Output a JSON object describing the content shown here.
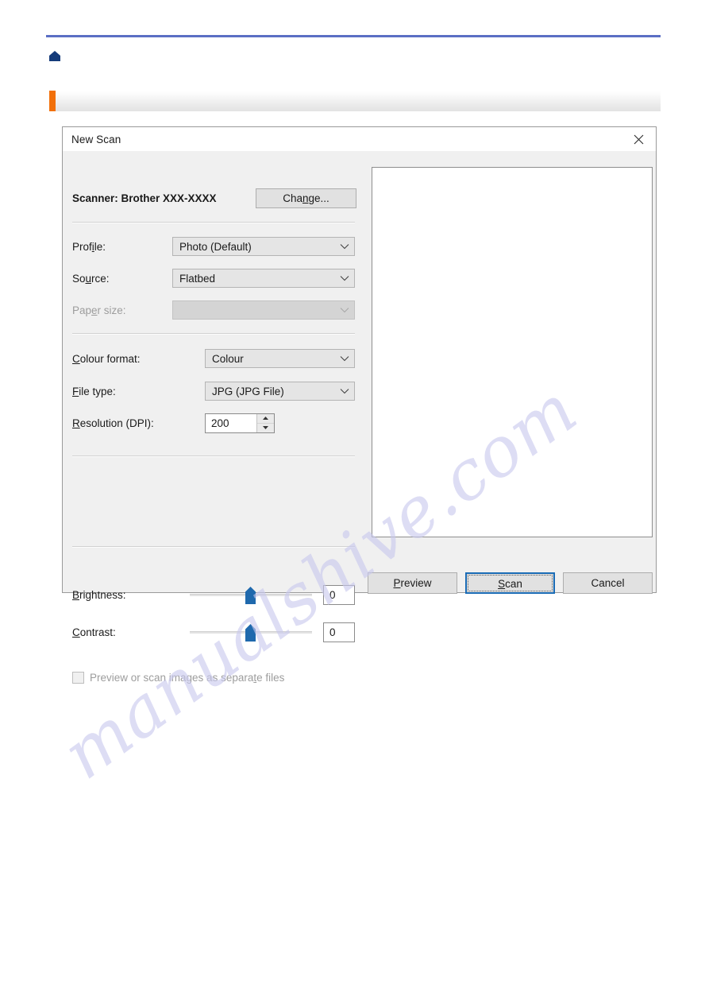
{
  "page": {
    "header": {
      "home_icon": "home-icon",
      "rule_color": "#5b6ec4",
      "accent_color": "#f2700a"
    },
    "watermark": {
      "text": "manualshive.com",
      "color": "#c9c9ee"
    }
  },
  "dialog": {
    "title": "New Scan",
    "close_icon": "close-icon",
    "scanner": {
      "label": "Scanner: Brother XXX-XXXX",
      "change_button": "Change..."
    },
    "fields": {
      "profile": {
        "label": "Profile:",
        "value": "Photo (Default)",
        "chevron_icon": "chevron-down-icon"
      },
      "source": {
        "label": "Source:",
        "value": "Flatbed",
        "chevron_icon": "chevron-down-icon"
      },
      "paper_size": {
        "label": "Paper size:",
        "value": "",
        "chevron_icon": "chevron-down-icon",
        "disabled": true
      },
      "colour_format": {
        "label": "Colour format:",
        "value": "Colour",
        "chevron_icon": "chevron-down-icon"
      },
      "file_type": {
        "label": "File type:",
        "value": "JPG (JPG File)",
        "chevron_icon": "chevron-down-icon"
      },
      "resolution": {
        "label": "Resolution (DPI):",
        "value": "200",
        "up_icon": "spin-up-icon",
        "down_icon": "spin-down-icon"
      },
      "brightness": {
        "label": "Brightness:",
        "value": "0",
        "thumb_color": "#1f69ad",
        "position_percent": 50
      },
      "contrast": {
        "label": "Contrast:",
        "value": "0",
        "thumb_color": "#1f69ad",
        "position_percent": 50
      },
      "separate_files": {
        "label": "Preview or scan images as separate files",
        "checked": false,
        "disabled": true
      }
    },
    "buttons": {
      "preview": "Preview",
      "scan": "Scan",
      "cancel": "Cancel"
    }
  }
}
